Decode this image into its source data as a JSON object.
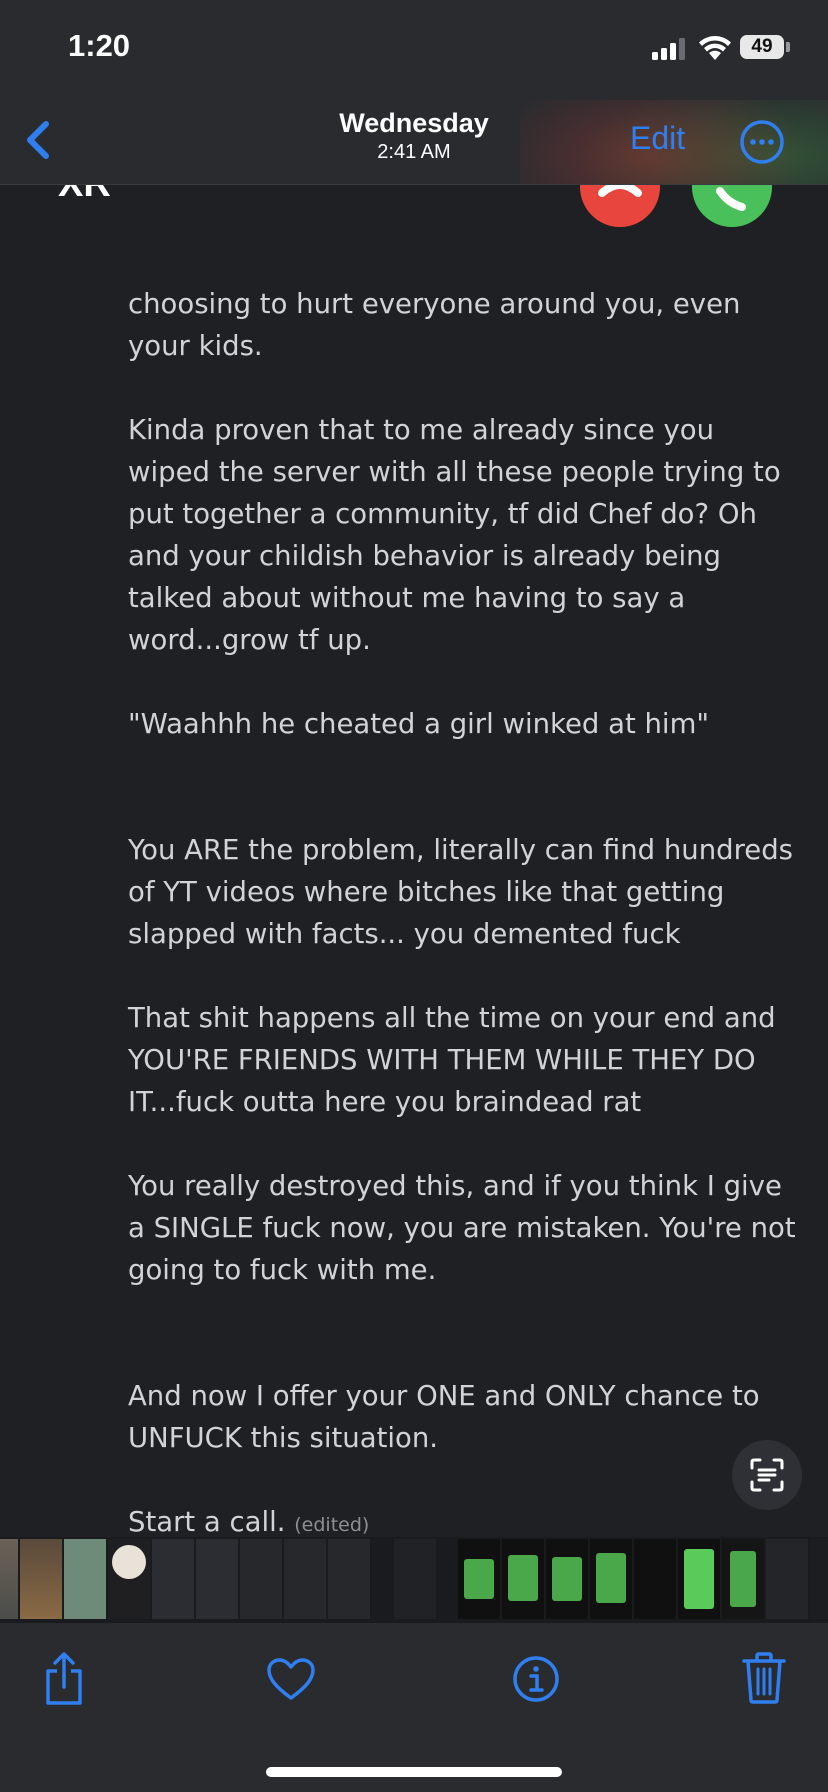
{
  "status_bar": {
    "time": "1:20",
    "battery": "49"
  },
  "nav": {
    "title": "Wednesday",
    "subtitle": "2:41 AM",
    "edit_label": "Edit",
    "back_icon": "chevron-left-icon",
    "more_icon": "ellipsis-circle-icon"
  },
  "photo": {
    "sender": "XR",
    "paragraphs": [
      "choosing to hurt everyone around you, even your kids.",
      "Kinda proven that to me already since you wiped the server with all these people trying to put together a community, tf did Chef do? Oh and your childish behavior is already being talked about without me having to say a word...grow tf up.",
      "\"Waahhh he cheated a girl winked at him\"",
      "You ARE the problem, literally can find hundreds of YT videos where bitches like that getting slapped with facts... you demented fuck",
      "That shit happens all the time on your end and YOU'RE FRIENDS WITH THEM WHILE THEY DO IT...fuck outta here you braindead rat",
      "You really destroyed this, and if you think I give a SINGLE fuck now, you are mistaken. You're not going to fuck with me.",
      "And now I offer your ONE and ONLY chance to UNFUCK this situation.",
      "Start a call."
    ],
    "edited_tag": "(edited)"
  },
  "colors": {
    "accent": "#2f7ff0",
    "decline": "#e8453c",
    "accept": "#49c05a",
    "background": "#1f2024",
    "bar": "#2a2b2f"
  },
  "toolbar": {
    "share_icon": "share-icon",
    "favorite_icon": "heart-icon",
    "info_icon": "info-icon",
    "delete_icon": "trash-icon"
  }
}
